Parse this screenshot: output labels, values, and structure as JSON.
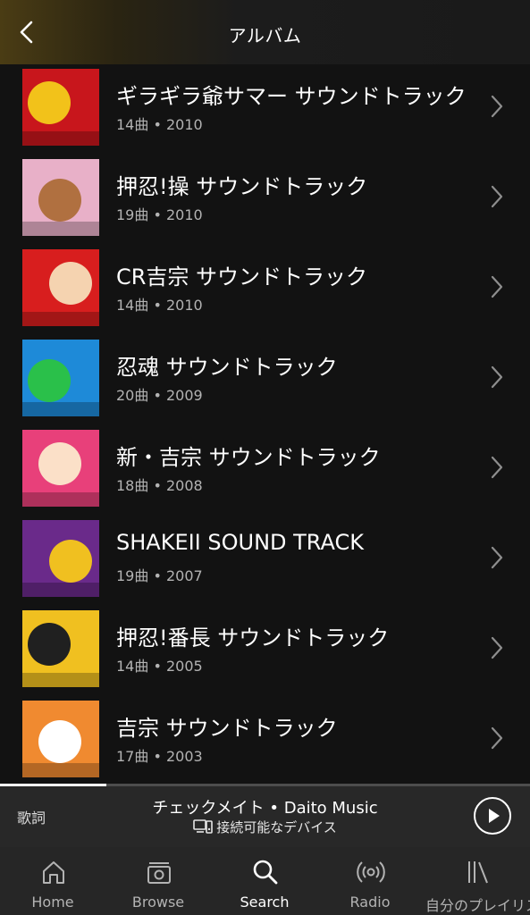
{
  "header": {
    "title": "アルバム"
  },
  "albums": [
    {
      "title": "ギラギラ爺サマー サウンドトラック",
      "meta": "14曲 • 2010",
      "cover_colors": [
        "#c8161c",
        "#f2c21a"
      ]
    },
    {
      "title": "押忍!操 サウンドトラック",
      "meta": "19曲 • 2010",
      "cover_colors": [
        "#e8b0c8",
        "#b07040"
      ]
    },
    {
      "title": "CR吉宗 サウンドトラック",
      "meta": "14曲 • 2010",
      "cover_colors": [
        "#d81e1e",
        "#f5d3b0"
      ]
    },
    {
      "title": "忍魂 サウンドトラック",
      "meta": "20曲 • 2009",
      "cover_colors": [
        "#1e8ad8",
        "#2ac04a"
      ]
    },
    {
      "title": "新・吉宗 サウンドトラック",
      "meta": "18曲 • 2008",
      "cover_colors": [
        "#e8407a",
        "#fbe0c8"
      ]
    },
    {
      "title": "SHAKEII SOUND TRACK",
      "meta": "19曲 • 2007",
      "cover_colors": [
        "#6a2a8a",
        "#f0c020"
      ]
    },
    {
      "title": "押忍!番長 サウンドトラック",
      "meta": "14曲 • 2005",
      "cover_colors": [
        "#f0c020",
        "#202020"
      ]
    },
    {
      "title": "吉宗 サウンドトラック",
      "meta": "17曲 • 2003",
      "cover_colors": [
        "#f08a30",
        "#ffffff"
      ]
    }
  ],
  "player": {
    "lyrics": "歌詞",
    "now_playing": "チェックメイト • Daito Music",
    "device": "接続可能なデバイス",
    "progress": 0.2
  },
  "tabs": [
    {
      "label": "Home",
      "icon": "home-icon",
      "active": false
    },
    {
      "label": "Browse",
      "icon": "browse-icon",
      "active": false
    },
    {
      "label": "Search",
      "icon": "search-icon",
      "active": true
    },
    {
      "label": "Radio",
      "icon": "radio-icon",
      "active": false
    },
    {
      "label": "自分のプレイリスト",
      "icon": "library-icon",
      "active": false
    }
  ]
}
